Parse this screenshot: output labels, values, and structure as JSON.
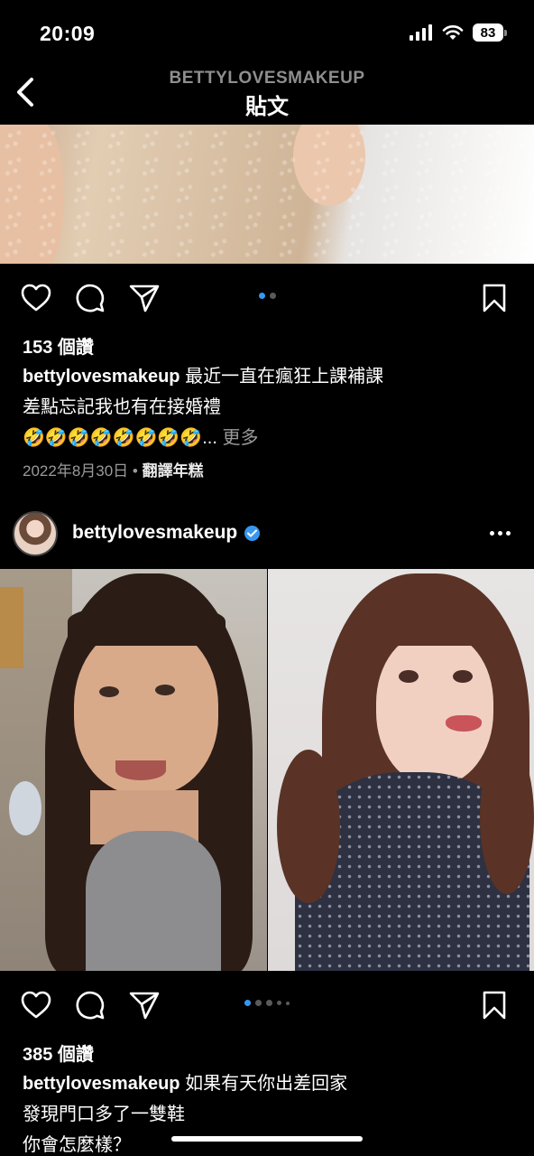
{
  "status_bar": {
    "time": "20:09",
    "battery": "83"
  },
  "header": {
    "username": "BETTYLOVESMAKEUP",
    "title": "貼文"
  },
  "post1": {
    "likes": "153 個讚",
    "caption_user": "bettylovesmakeup",
    "caption_line1": "最近一直在瘋狂上課補課",
    "caption_line2": "差點忘記我也有在接婚禮",
    "caption_line3": "🤣🤣🤣🤣🤣🤣🤣🤣...",
    "more": "更多",
    "date": "2022年8月30日",
    "separator": "•",
    "translate": "翻譯年糕",
    "carousel": {
      "count": 2,
      "active": 0
    }
  },
  "post2": {
    "username": "bettylovesmakeup",
    "likes": "385 個讚",
    "caption_user": "bettylovesmakeup",
    "caption_line1": "如果有天你出差回家",
    "caption_line2": "發現門口多了一雙鞋",
    "caption_line3": "你會怎麼樣？",
    "carousel": {
      "count": 5,
      "active": 0
    }
  },
  "colors": {
    "accent": "#3797f0",
    "background": "#000000",
    "muted": "#9a9a9a"
  },
  "icons": [
    "back-chevron-icon",
    "heart-icon",
    "comment-icon",
    "share-icon",
    "bookmark-icon",
    "verified-icon",
    "more-icon",
    "signal-icon",
    "wifi-icon",
    "battery-icon"
  ]
}
